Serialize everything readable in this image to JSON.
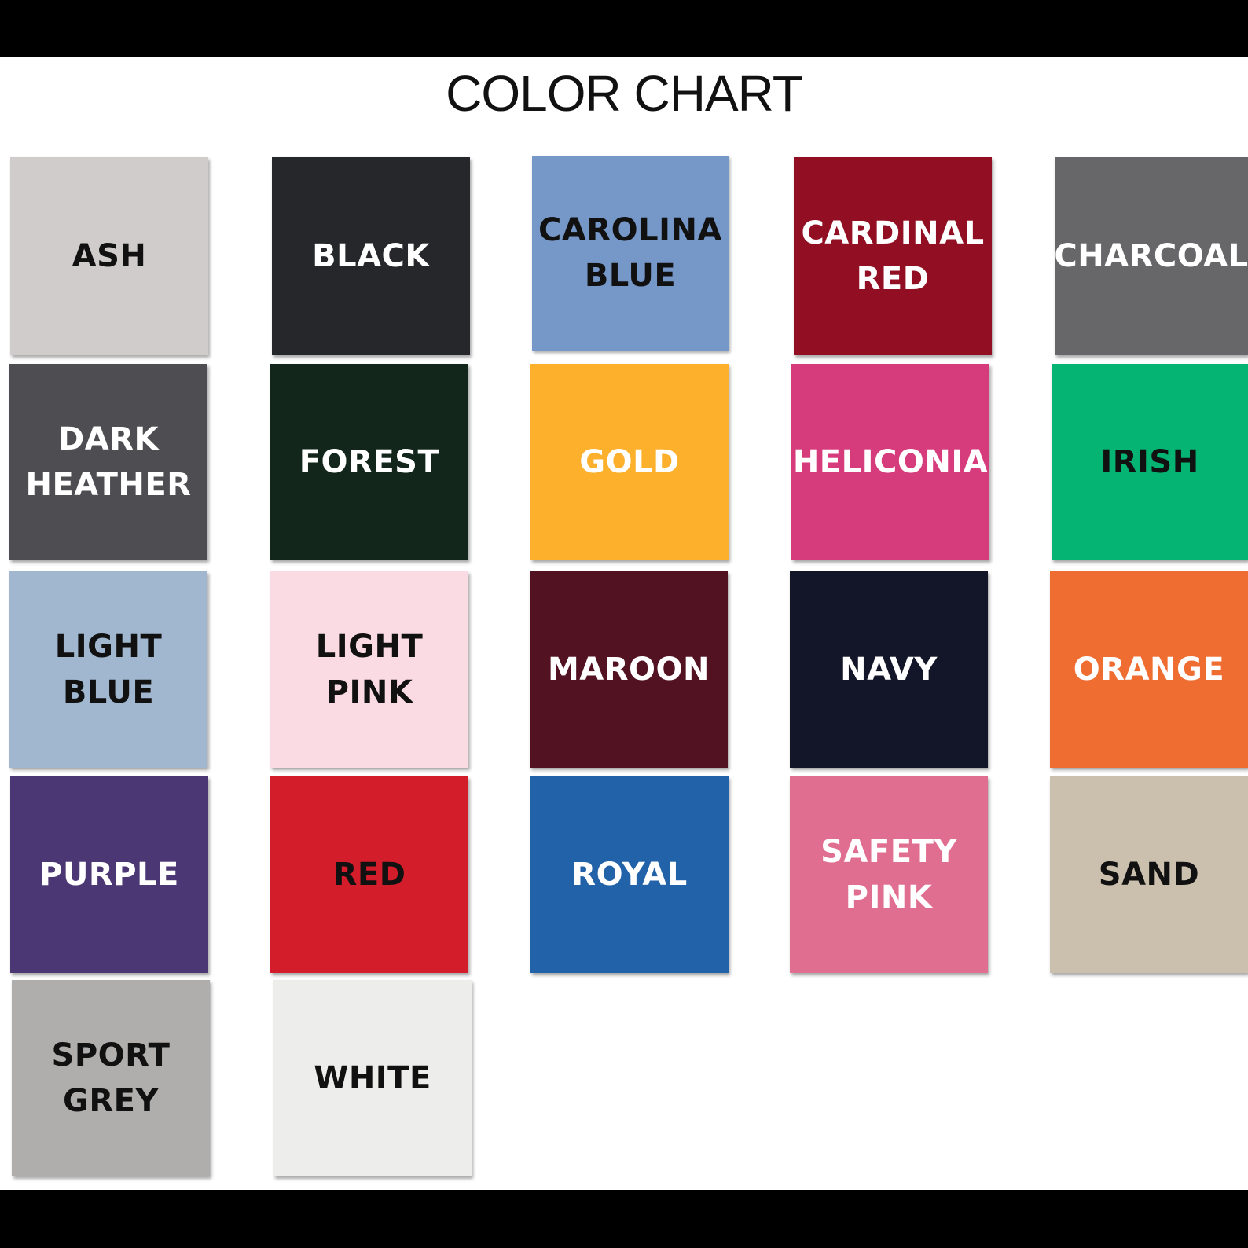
{
  "title": "COLOR CHART",
  "swatches": [
    {
      "label": "ASH",
      "color": "#d0cccc",
      "text_color": "#111111"
    },
    {
      "label": "BLACK",
      "color": "#25272a",
      "text_color": "#ffffff"
    },
    {
      "label": "CAROLINA\nBLUE",
      "color": "#7698c8",
      "text_color": "#111111"
    },
    {
      "label": "CARDINAL\nRED",
      "color": "#920f23",
      "text_color": "#ffffff"
    },
    {
      "label": "CHARCOAL",
      "color": "#67676a",
      "text_color": "#ffffff"
    },
    {
      "label": "DARK\nHEATHER",
      "color": "#4e4d51",
      "text_color": "#ffffff"
    },
    {
      "label": "FOREST",
      "color": "#12261b",
      "text_color": "#ffffff"
    },
    {
      "label": "GOLD",
      "color": "#fcb02c",
      "text_color": "#ffffff"
    },
    {
      "label": "HELICONIA",
      "color": "#d63b7b",
      "text_color": "#ffffff"
    },
    {
      "label": "IRISH",
      "color": "#05b473",
      "text_color": "#111111"
    },
    {
      "label": "LIGHT BLUE",
      "color": "#a0b7cf",
      "text_color": "#111111"
    },
    {
      "label": "LIGHT PINK",
      "color": "#fadbe3",
      "text_color": "#111111"
    },
    {
      "label": "MAROON",
      "color": "#531221",
      "text_color": "#ffffff"
    },
    {
      "label": "NAVY",
      "color": "#131629",
      "text_color": "#ffffff"
    },
    {
      "label": "ORANGE",
      "color": "#f06d31",
      "text_color": "#ffffff"
    },
    {
      "label": "PURPLE",
      "color": "#4b3773",
      "text_color": "#ffffff"
    },
    {
      "label": "RED",
      "color": "#d31d2b",
      "text_color": "#111111"
    },
    {
      "label": "ROYAL",
      "color": "#2162a8",
      "text_color": "#ffffff"
    },
    {
      "label": "SAFETY\nPINK",
      "color": "#e06e90",
      "text_color": "#ffffff"
    },
    {
      "label": "SAND",
      "color": "#cbbfae",
      "text_color": "#111111"
    },
    {
      "label": "SPORT\nGREY",
      "color": "#b0adad",
      "text_color": "#111111"
    },
    {
      "label": "WHITE",
      "color": "#ededeb",
      "text_color": "#111111"
    }
  ]
}
